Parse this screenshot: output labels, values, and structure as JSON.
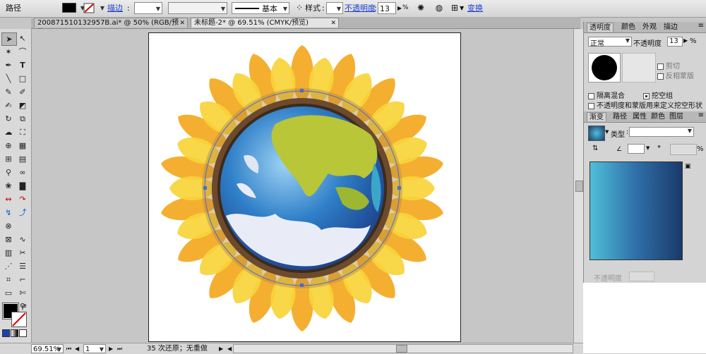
{
  "control_bar": {
    "object_type": "路径",
    "stroke_label": "描边",
    "stroke_profile": "基本",
    "style_label": "样式",
    "opacity_label": "不透明度",
    "opacity_value": "13",
    "percent": "%",
    "transform_label": "变换"
  },
  "tabs": [
    {
      "label": "200871510132957B.ai* @ 50% (RGB/预览)",
      "close": "✕"
    },
    {
      "label": "未标题-2* @ 69.51% (CMYK/预览)",
      "close": "✕"
    }
  ],
  "status": {
    "zoom": "69.51%",
    "page": "1",
    "undo_text": "35 次还原；无重做"
  },
  "transparency_panel": {
    "tabs": [
      "透明度",
      "颜色",
      "外观",
      "描边"
    ],
    "blend_mode": "正常",
    "opacity_label": "不透明度",
    "opacity_value": "13",
    "percent": "%",
    "clip_label": "剪切",
    "invert_mask_label": "反相蒙版",
    "isolate_blend_label": "隔离混合",
    "knockout_group_label": "挖空组",
    "define_knockout_label": "不透明度和蒙版用来定义挖空形状"
  },
  "gradient_panel": {
    "tabs": [
      "渐变",
      "路径",
      "属性",
      "颜色",
      "图层"
    ],
    "type_label": "类型",
    "percent": "%",
    "opacity_label": "不透明度"
  },
  "colors": {
    "gradient_start": "#4fbfd9",
    "gradient_end": "#1a3a6a",
    "petal_light": "#f7d43a",
    "petal_dark": "#f3a820",
    "ring": "#6b4a2e",
    "globe_blue": "#2f7fc8",
    "land_yellow": "#b8c638"
  }
}
